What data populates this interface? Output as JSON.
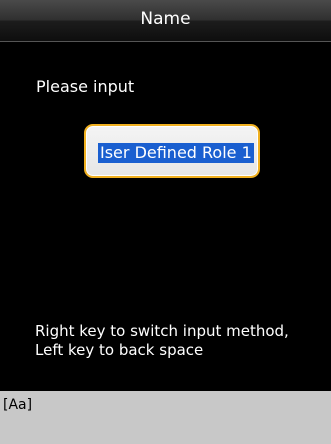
{
  "header": {
    "title": "Name"
  },
  "main": {
    "prompt": "Please input",
    "input_value": "Iser Defined Role 1",
    "hint_line1": "Right key to switch input method,",
    "hint_line2": "Left key to back space"
  },
  "ime": {
    "mode_label": "[Aa]"
  },
  "colors": {
    "background": "#000000",
    "input_border": "#f0b020",
    "selection": "#1a5fd0",
    "ime_bar": "#c8c8c8"
  }
}
